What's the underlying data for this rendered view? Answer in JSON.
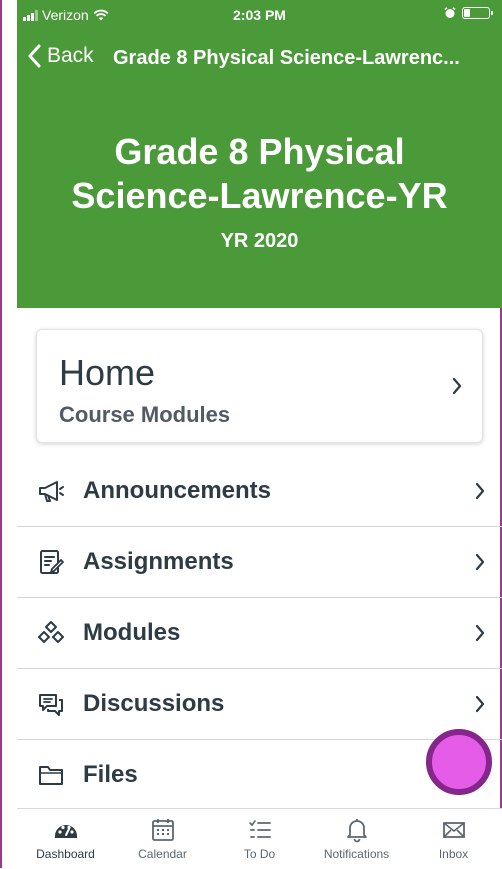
{
  "status_bar": {
    "carrier": "Verizon",
    "time": "2:03 PM",
    "battery_level": 0.25
  },
  "nav": {
    "back_label": "Back",
    "title": "Grade 8 Physical Science-Lawrenc..."
  },
  "header": {
    "course_title_line1": "Grade 8 Physical",
    "course_title_line2": "Science-Lawrence-YR",
    "term": "YR 2020",
    "color": "#4b9a3a"
  },
  "home": {
    "title": "Home",
    "subtitle": "Course Modules"
  },
  "menu": [
    {
      "label": "Announcements",
      "icon": "megaphone-icon"
    },
    {
      "label": "Assignments",
      "icon": "assignment-icon"
    },
    {
      "label": "Modules",
      "icon": "modules-icon"
    },
    {
      "label": "Discussions",
      "icon": "discussion-icon"
    },
    {
      "label": "Files",
      "icon": "folder-icon"
    }
  ],
  "tabs": [
    {
      "label": "Dashboard",
      "icon": "dashboard-icon",
      "active": true
    },
    {
      "label": "Calendar",
      "icon": "calendar-icon"
    },
    {
      "label": "To Do",
      "icon": "todo-icon"
    },
    {
      "label": "Notifications",
      "icon": "bell-icon"
    },
    {
      "label": "Inbox",
      "icon": "inbox-icon"
    }
  ],
  "colors": {
    "fab_fill": "#e55ce8",
    "fab_ring": "#85278a",
    "text_dark": "#2d3b45"
  }
}
